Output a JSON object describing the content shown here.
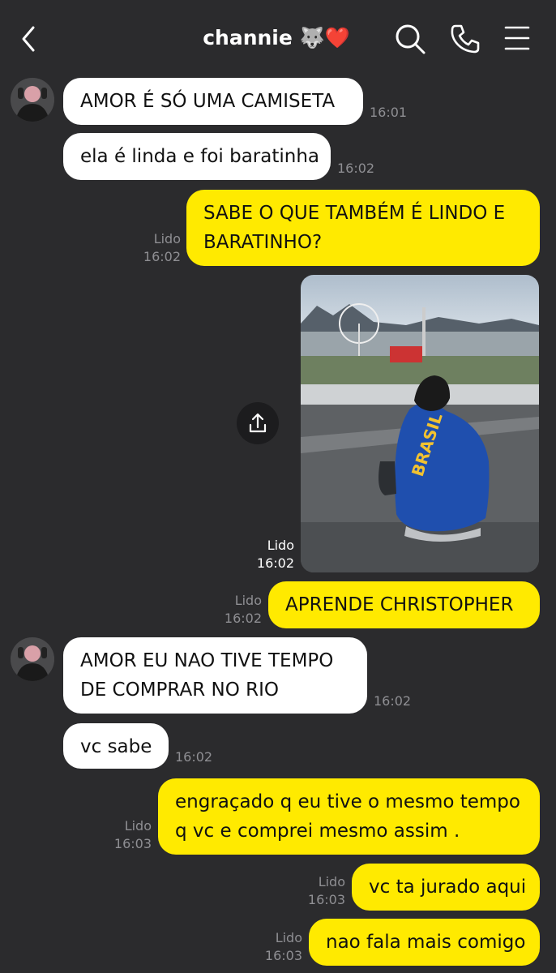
{
  "header": {
    "title": "channie",
    "emoji": "🐺❤️",
    "icons": [
      "back-icon",
      "search-icon",
      "phone-icon",
      "menu-icon"
    ]
  },
  "colors": {
    "background": "#2b2b2d",
    "incoming_bubble": "#ffffff",
    "outgoing_bubble": "#ffea00",
    "meta_text": "#8f8f93"
  },
  "messages": [
    {
      "dir": "in",
      "text": "AMOR É SÓ UMA CAMISETA",
      "time": "16:01"
    },
    {
      "dir": "in",
      "text": "ela é linda e foi baratinha",
      "time": "16:02"
    },
    {
      "dir": "out",
      "lines": [
        "SABE O QUE TAMBÉM É LINDO E",
        "BARATINHO?"
      ],
      "read": "Lido",
      "time": "16:02"
    },
    {
      "dir": "out",
      "type": "image",
      "read": "Lido",
      "time": "16:02",
      "jacket_text": "BRASIL"
    },
    {
      "dir": "out",
      "text": "APRENDE CHRISTOPHER",
      "read": "Lido",
      "time": "16:02"
    },
    {
      "dir": "in",
      "lines": [
        "AMOR EU NAO TIVE TEMPO",
        "DE COMPRAR NO RIO"
      ],
      "time": "16:02"
    },
    {
      "dir": "in",
      "text": "vc sabe",
      "time": "16:02"
    },
    {
      "dir": "out",
      "lines": [
        "engraçado q eu tive o mesmo tempo",
        "q vc e comprei mesmo assim ."
      ],
      "read": "Lido",
      "time": "16:03"
    },
    {
      "dir": "out",
      "text": "vc ta jurado aqui",
      "read": "Lido",
      "time": "16:03"
    },
    {
      "dir": "out",
      "text": "nao fala mais comigo",
      "read": "Lido",
      "time": "16:03"
    }
  ]
}
